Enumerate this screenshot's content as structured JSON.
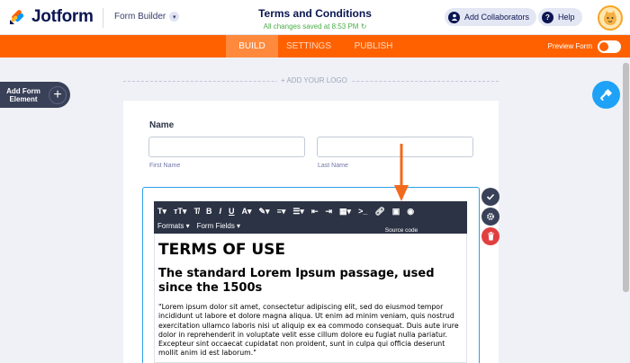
{
  "header": {
    "brand": "Jotform",
    "mode": "Form Builder",
    "form_title": "Terms and Conditions",
    "saved_status": "All changes saved at 8:53 PM",
    "collaborators_label": "Add Collaborators",
    "help_label": "Help"
  },
  "navbar": {
    "tabs": [
      "BUILD",
      "SETTINGS",
      "PUBLISH"
    ],
    "active_tab": "BUILD",
    "preview_label": "Preview Form"
  },
  "sidebar": {
    "add_element_label": "Add Form Element"
  },
  "canvas": {
    "add_logo_label": "+ ADD YOUR LOGO"
  },
  "form": {
    "name_label": "Name",
    "first_name_sub": "First Name",
    "last_name_sub": "Last Name"
  },
  "editor": {
    "tooltip": "Source code",
    "formats_label": "Formats",
    "form_fields_label": "Form Fields",
    "heading1": "TERMS OF USE",
    "heading2": "The standard Lorem Ipsum passage, used since the 1500s",
    "paragraph": "\"Lorem ipsum dolor sit amet, consectetur adipiscing elit, sed do eiusmod tempor incididunt ut labore et dolore magna aliqua. Ut enim ad minim veniam, quis nostrud exercitation ullamco laboris nisi ut aliquip ex ea commodo consequat. Duis aute irure dolor in reprehenderit in voluptate velit esse cillum dolore eu fugiat nulla pariatur. Excepteur sint occaecat cupidatat non proident, sunt in culpa qui officia deserunt mollit anim id est laborum.\""
  },
  "colors": {
    "brand_orange": "#ff6100",
    "navy": "#0a1551",
    "selection_blue": "#2ea0e7",
    "delete_red": "#e13f3f",
    "paint_blue": "#1ea2f8"
  }
}
